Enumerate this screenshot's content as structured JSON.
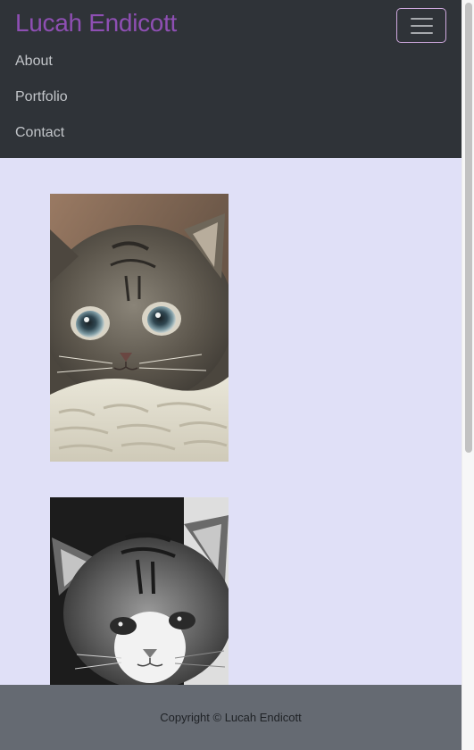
{
  "navbar": {
    "brand": "Lucah Endicott",
    "toggle_icon": "hamburger-icon",
    "links": [
      "About",
      "Portfolio",
      "Contact"
    ]
  },
  "gallery": {
    "images": [
      {
        "subject": "kitten",
        "style": "color"
      },
      {
        "subject": "kitten",
        "style": "grayscale"
      }
    ]
  },
  "footer": {
    "copyright": "Copyright © Lucah Endicott"
  },
  "colors": {
    "navbar_bg": "#2f3338",
    "brand": "#8e4fb3",
    "page_bg": "#e0e0f7",
    "footer_bg": "#656a72"
  }
}
